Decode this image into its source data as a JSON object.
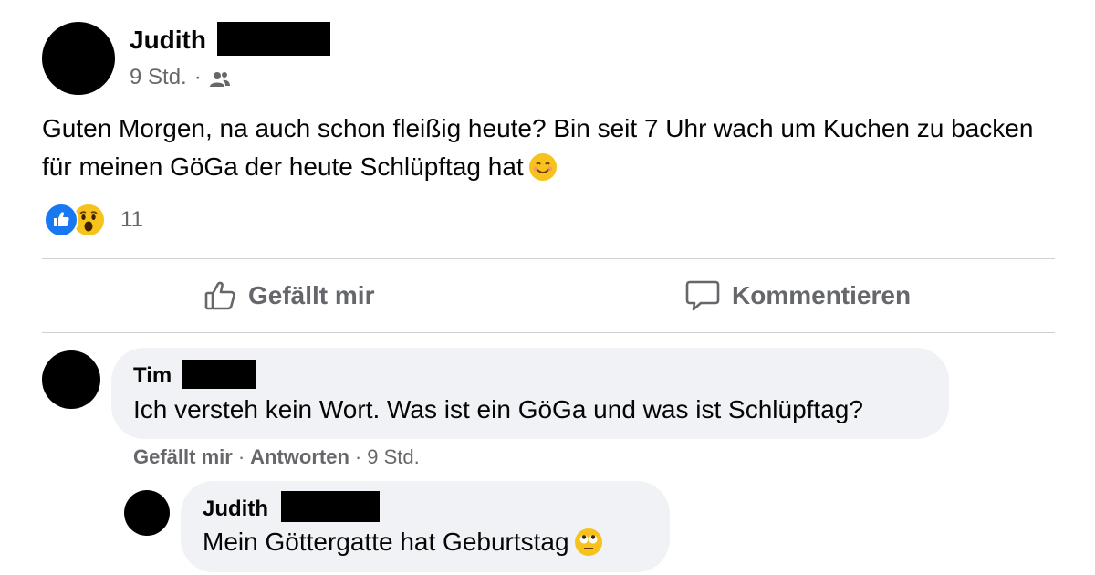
{
  "post": {
    "author": "Judith",
    "time": "9 Std.",
    "meta_separator": "·",
    "audience_icon": "friends-icon",
    "text": "Guten Morgen, na auch schon fleißig heute? Bin seit 7 Uhr wach um Kuchen zu backen für meinen GöGa der heute Schlüpftag hat",
    "reaction_count": "11",
    "reactions": [
      "like",
      "wow"
    ]
  },
  "actions": {
    "like_label": "Gefällt mir",
    "comment_label": "Kommentieren"
  },
  "comments": [
    {
      "author": "Tim",
      "text": "Ich versteh kein Wort. Was ist ein GöGa und was ist Schlüpftag?",
      "like_label": "Gefällt mir",
      "reply_label": "Antworten",
      "time": "9 Std.",
      "separator": "·"
    },
    {
      "author": "Judith",
      "text": "Mein Göttergatte hat Geburtstag"
    }
  ],
  "colors": {
    "text": "#050505",
    "secondary": "#65676b",
    "bubble": "#f0f2f5",
    "like_blue": "#1877f2",
    "emoji_yellow": "#f7c21b",
    "divider": "#ced0d4"
  }
}
